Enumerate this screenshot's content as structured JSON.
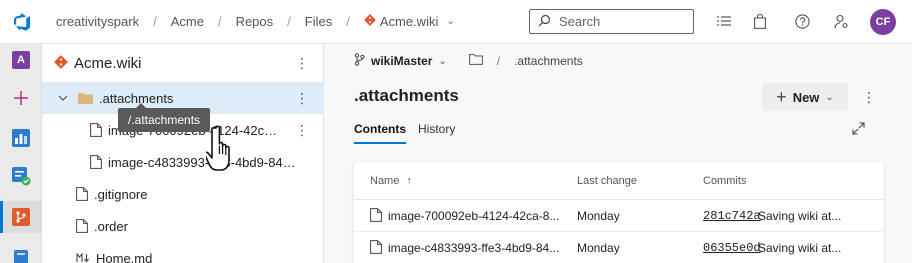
{
  "header": {
    "breadcrumbs": [
      "creativityspark",
      "Acme",
      "Repos",
      "Files"
    ],
    "repo": "Acme.wiki",
    "search_placeholder": "Search",
    "avatar_initials": "CF"
  },
  "rail": {
    "org_initial": "A"
  },
  "tree": {
    "title": "Acme.wiki",
    "items": [
      {
        "label": ".attachments",
        "type": "folder"
      },
      {
        "label": "image-700092eb-4124-42ca-8ec...",
        "type": "file"
      },
      {
        "label": "image-c4833993-ffe3-4bd9-8433...",
        "type": "file"
      },
      {
        "label": ".gitignore",
        "type": "file"
      },
      {
        "label": ".order",
        "type": "file"
      },
      {
        "label": "Home.md",
        "type": "markdown"
      }
    ],
    "tooltip": "/.attachments"
  },
  "content": {
    "branch": "wikiMaster",
    "path": ".attachments",
    "title": ".attachments",
    "new_button": "New",
    "tabs": [
      "Contents",
      "History"
    ],
    "columns": [
      "Name",
      "Last change",
      "Commits"
    ],
    "rows": [
      {
        "name": "image-700092eb-4124-42ca-8...",
        "last_change": "Monday",
        "commit_id": "281c742a",
        "commit_msg": "Saving wiki at..."
      },
      {
        "name": "image-c4833993-ffe3-4bd9-84...",
        "last_change": "Monday",
        "commit_id": "06355e0d",
        "commit_msg": "Saving wiki at..."
      }
    ]
  },
  "colors": {
    "accent": "#0078d4",
    "avatar": "#7a3fa0",
    "git_orange": "#e05a2b",
    "selected_row": "#deecf9"
  }
}
